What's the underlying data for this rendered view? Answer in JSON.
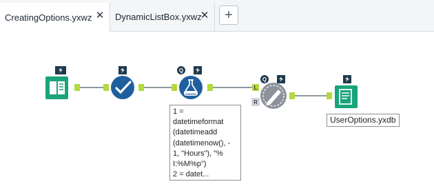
{
  "tabs": [
    {
      "label": "CreatingOptions.yxwz",
      "active": true,
      "close_glyph": "✕"
    },
    {
      "label": "DynamicListBox.yxwz",
      "active": false,
      "close_glyph": "✕"
    }
  ],
  "add_tab_glyph": "+",
  "workflow": {
    "tools": [
      {
        "name": "input-data-tool",
        "icon": "book-icon",
        "color": "#19a47a",
        "badges": [
          "lightning"
        ]
      },
      {
        "name": "select-tool",
        "icon": "checkmark-icon",
        "color": "#1f5f9e",
        "badges": [
          "lightning"
        ]
      },
      {
        "name": "formula-tool",
        "icon": "flask-icon",
        "color": "#1f5f9e",
        "badges": [
          "question",
          "lightning"
        ]
      },
      {
        "name": "formula-join-tool",
        "icon": "pen-gear-icon",
        "color": "#8c9299",
        "badges": [
          "question",
          "lightning"
        ]
      },
      {
        "name": "output-data-tool",
        "icon": "document-icon",
        "color": "#19a47a",
        "badges": [
          "lightning"
        ]
      }
    ],
    "anchor_labels": {
      "left": "L",
      "right": "R"
    },
    "annotation_text": "1 =\ndatetimeformat\n(datetimeadd\n(datetimenow(), -\n1, \"Hours\"), \"%\nI:%M%p\")\n2 = datet...",
    "output_label": "UserOptions.yxdb"
  },
  "colors": {
    "connector": "#4f5b66",
    "anchor": "#b3d93f",
    "green_tool": "#19a47a",
    "blue_tool": "#1f5f9e",
    "gray_tool": "#8c9299"
  }
}
